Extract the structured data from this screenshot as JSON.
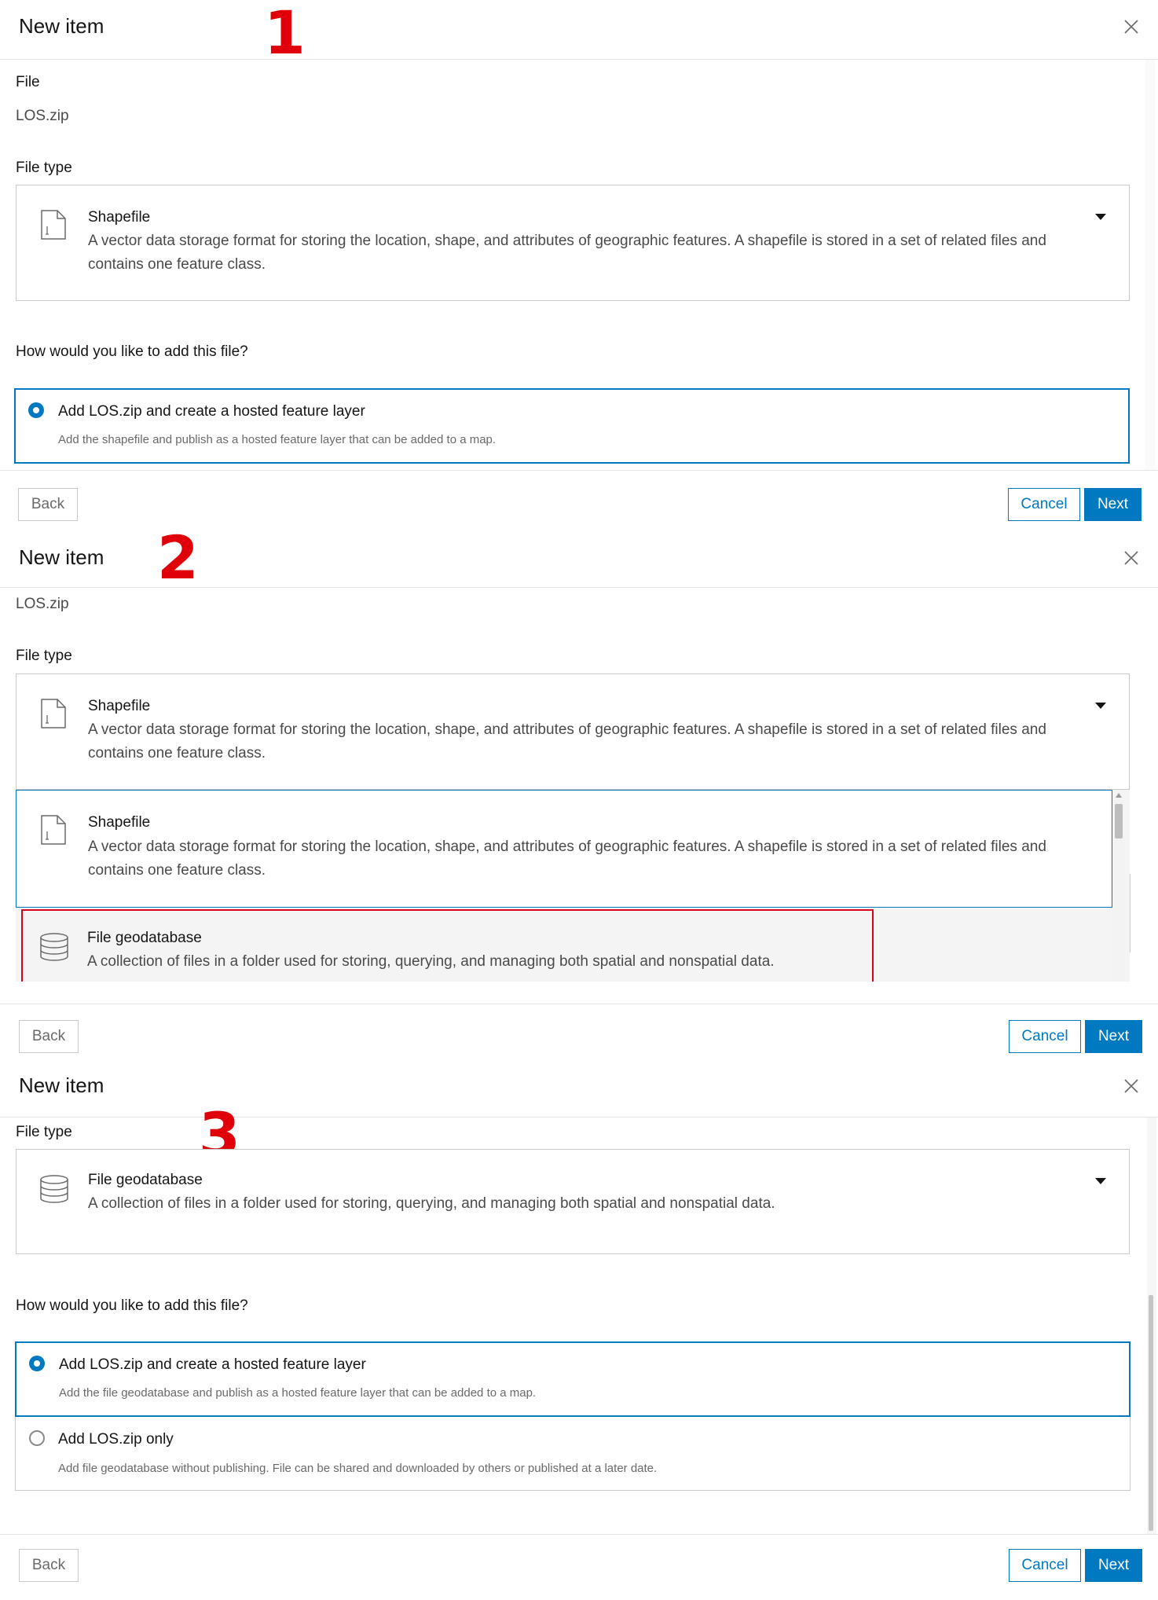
{
  "panel1": {
    "step": "1",
    "title": "New item",
    "file_label": "File",
    "file_value": "LOS.zip",
    "file_type_label": "File type",
    "file_type": {
      "icon": "shapefile-icon",
      "title": "Shapefile",
      "desc_line1": "A vector data storage format for storing the location, shape, and attributes of geographic features. A shapefile is stored in a set of related files and",
      "desc_line2": "contains one feature class."
    },
    "question": "How would you like to add this file?",
    "options": [
      {
        "title": "Add LOS.zip and create a hosted feature layer",
        "desc": "Add the shapefile and publish as a hosted feature layer that can be added to a map.",
        "selected": true
      }
    ],
    "back": "Back",
    "cancel": "Cancel",
    "next": "Next"
  },
  "panel2": {
    "step": "2",
    "title": "New item",
    "file_value": "LOS.zip",
    "file_type_label": "File type",
    "file_type": {
      "title": "Shapefile",
      "desc_line1": "A vector data storage format for storing the location, shape, and attributes of geographic features. A shapefile is stored in a set of related files and",
      "desc_line2": "contains one feature class."
    },
    "dropdown": [
      {
        "icon": "shapefile-icon",
        "title": "Shapefile",
        "desc_line1": "A vector data storage format for storing the location, shape, and attributes of geographic features. A shapefile is stored in a set of related files and",
        "desc_line2": "contains one feature class."
      },
      {
        "icon": "database-icon",
        "title": "File geodatabase",
        "desc_line1": "A collection of files in a folder used for storing, querying, and managing both spatial and nonspatial data.",
        "highlight_color": "#d9001b"
      }
    ],
    "back": "Back",
    "cancel": "Cancel",
    "next": "Next"
  },
  "panel3": {
    "step": "3",
    "title": "New item",
    "file_type_label": "File type",
    "file_type": {
      "icon": "database-icon",
      "title": "File geodatabase",
      "desc_line1": "A collection of files in a folder used for storing, querying, and managing both spatial and nonspatial data."
    },
    "question": "How would you like to add this file?",
    "options": [
      {
        "title": "Add LOS.zip and create a hosted feature layer",
        "desc": "Add the file geodatabase and publish as a hosted feature layer that can be added to a map.",
        "selected": true
      },
      {
        "title": "Add LOS.zip only",
        "desc": "Add file geodatabase without publishing. File can be shared and downloaded by others or published at a later date.",
        "selected": false
      }
    ],
    "back": "Back",
    "cancel": "Cancel",
    "next": "Next"
  },
  "colors": {
    "accent": "#0079c1",
    "step_number": "#e0000a",
    "highlight": "#d9001b"
  }
}
